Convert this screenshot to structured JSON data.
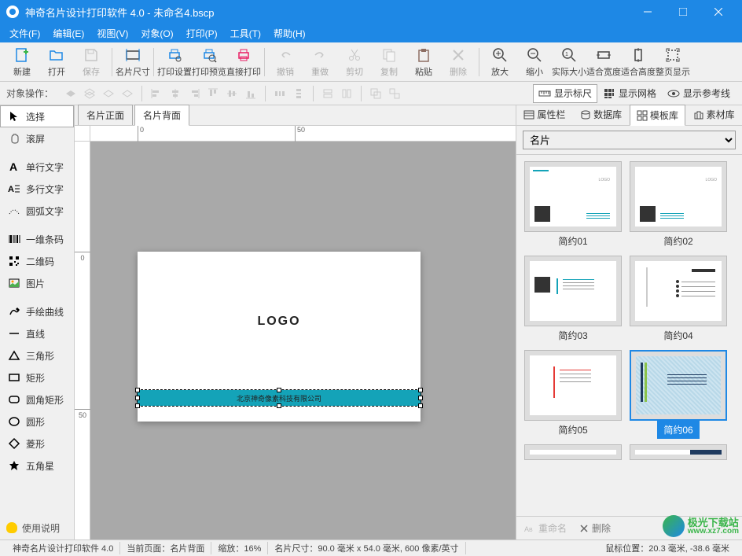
{
  "titlebar": {
    "title": "神奇名片设计打印软件 4.0 - 未命名4.bscp"
  },
  "menu": [
    "文件(F)",
    "编辑(E)",
    "视图(V)",
    "对象(O)",
    "打印(P)",
    "工具(T)",
    "帮助(H)"
  ],
  "toolbar": {
    "new": "新建",
    "open": "打开",
    "save": "保存",
    "cardsize": "名片尺寸",
    "printset": "打印设置",
    "printpreview": "打印预览",
    "printdirect": "直接打印",
    "undo": "撤销",
    "redo": "重做",
    "cut": "剪切",
    "copy": "复制",
    "paste": "粘贴",
    "delete": "删除",
    "zoomin": "放大",
    "zoomout": "缩小",
    "actualsize": "实际大小",
    "fitwidth": "适合宽度",
    "fitheight": "适合高度",
    "fitpage": "整页显示"
  },
  "sectoolbar": {
    "label": "对象操作：",
    "showruler": "显示标尺",
    "showgrid": "显示网格",
    "showguide": "显示参考线"
  },
  "tools": {
    "select": "选择",
    "pan": "滚屏",
    "text1": "单行文字",
    "text2": "多行文字",
    "arctext": "圆弧文字",
    "barcode": "一维条码",
    "qrcode": "二维码",
    "image": "图片",
    "freehand": "手绘曲线",
    "line": "直线",
    "triangle": "三角形",
    "rect": "矩形",
    "roundrect": "圆角矩形",
    "ellipse": "圆形",
    "diamond": "菱形",
    "star": "五角星",
    "help": "使用说明"
  },
  "canvasTabs": {
    "front": "名片正面",
    "back": "名片背面"
  },
  "canvas": {
    "logo": "LOGO",
    "company": "北京神奇像素科技有限公司"
  },
  "ruler_h": [
    "0",
    "50"
  ],
  "ruler_v": [
    "0",
    "50"
  ],
  "rightTabs": {
    "properties": "属性栏",
    "database": "数据库",
    "template": "模板库",
    "material": "素材库"
  },
  "templateCategory": "名片",
  "templates": [
    "简约01",
    "简约02",
    "简约03",
    "简约04",
    "简约05",
    "简约06"
  ],
  "templateActions": {
    "rename": "重命名",
    "delete": "删除"
  },
  "statusbar": {
    "app": "神奇名片设计打印软件 4.0",
    "page": "当前页面：名片背面",
    "zoom": "缩放：16%",
    "size": "名片尺寸：90.0 毫米 x 54.0 毫米, 600 像素/英寸",
    "mouse": "鼠标位置：20.3 毫米, -38.6 毫米"
  },
  "watermark": {
    "name": "极光下载站",
    "url": "www.xz7.com"
  }
}
